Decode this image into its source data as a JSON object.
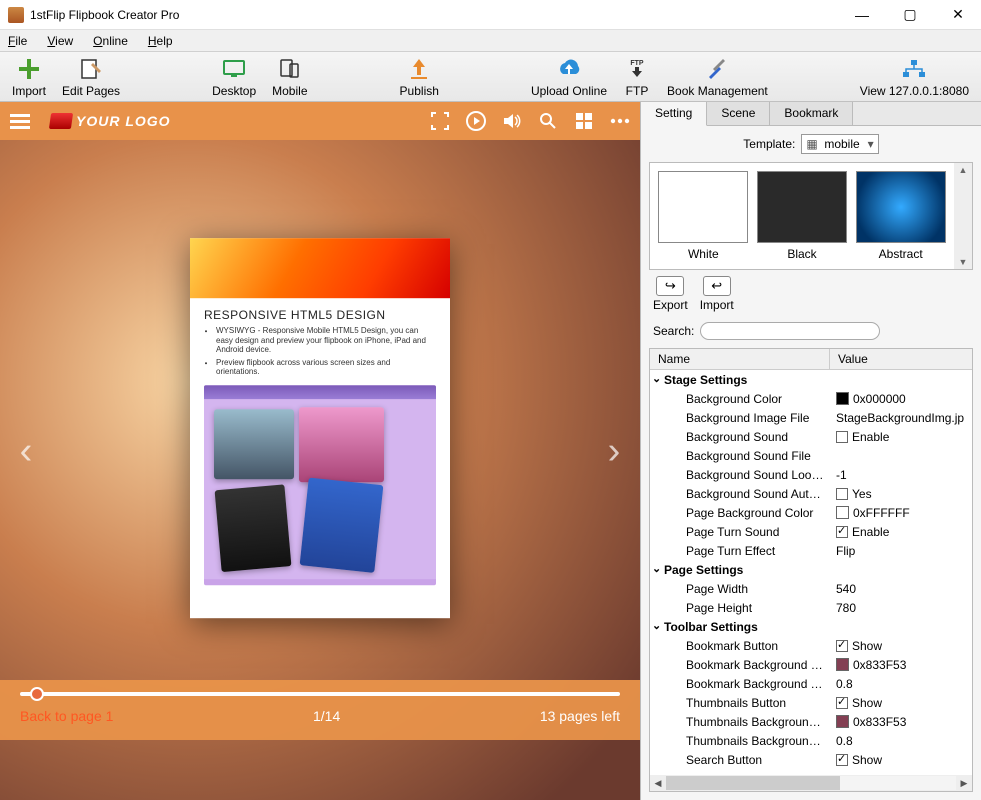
{
  "window": {
    "title": "1stFlip Flipbook Creator Pro"
  },
  "menu": {
    "file": "File",
    "view": "View",
    "online": "Online",
    "help": "Help"
  },
  "toolbar": {
    "import": "Import",
    "edit_pages": "Edit Pages",
    "desktop": "Desktop",
    "mobile": "Mobile",
    "publish": "Publish",
    "upload": "Upload Online",
    "ftp": "FTP",
    "book_mgmt": "Book Management",
    "view_addr": "View 127.0.0.1:8080"
  },
  "preview": {
    "logo": "YOUR LOGO",
    "book": {
      "heading": "RESPONSIVE HTML5 DESIGN",
      "b1": "WYSIWYG - Responsive Mobile HTML5 Design, you can easy design and preview your flipbook on iPhone, iPad and Android device.",
      "b2": "Preview flipbook across various screen sizes and orientations."
    },
    "back": "Back to page 1",
    "page": "1/14",
    "left": "13 pages left"
  },
  "panel": {
    "tabs": {
      "setting": "Setting",
      "scene": "Scene",
      "bookmark": "Bookmark"
    },
    "template_label": "Template:",
    "template_value": "mobile",
    "thumbs": {
      "white": "White",
      "black": "Black",
      "abstract": "Abstract"
    },
    "export": "Export",
    "import": "Import",
    "search_label": "Search:",
    "search_placeholder": "",
    "grid": {
      "name": "Name",
      "value": "Value"
    },
    "sections": {
      "stage": "Stage Settings",
      "page": "Page Settings",
      "toolbar": "Toolbar Settings"
    },
    "props": {
      "bg_color": {
        "n": "Background Color",
        "v": "0x000000",
        "c": "#000000"
      },
      "bg_img": {
        "n": "Background Image File",
        "v": "StageBackgroundImg.jp"
      },
      "bg_sound": {
        "n": "Background Sound",
        "v": "Enable",
        "chk": false
      },
      "bg_sound_file": {
        "n": "Background Sound File",
        "v": ""
      },
      "bg_sound_loops": {
        "n": "Background Sound Loops",
        "v": "-1"
      },
      "bg_sound_auto": {
        "n": "Background Sound Autoplay",
        "v": "Yes",
        "chk": false
      },
      "page_bg": {
        "n": "Page Background Color",
        "v": "0xFFFFFF",
        "c": "#FFFFFF"
      },
      "page_turn_sound": {
        "n": "Page Turn Sound",
        "v": "Enable",
        "chk": true
      },
      "page_turn_eff": {
        "n": "Page Turn Effect",
        "v": "Flip"
      },
      "page_w": {
        "n": "Page Width",
        "v": "540"
      },
      "page_h": {
        "n": "Page Height",
        "v": "780"
      },
      "bookmark_btn": {
        "n": "Bookmark Button",
        "v": "Show",
        "chk": true
      },
      "bookmark_bg": {
        "n": "Bookmark Background Color",
        "v": "0x833F53",
        "c": "#833F53"
      },
      "bookmark_bg_tr": {
        "n": "Bookmark Background Tra...",
        "v": "0.8"
      },
      "thumbs_btn": {
        "n": "Thumbnails Button",
        "v": "Show",
        "chk": true
      },
      "thumbs_bg": {
        "n": "Thumbnails Background C...",
        "v": "0x833F53",
        "c": "#833F53"
      },
      "thumbs_bg_tr": {
        "n": "Thumbnails Background Tr...",
        "v": "0.8"
      },
      "search_btn": {
        "n": "Search Button",
        "v": "Show",
        "chk": true
      }
    }
  }
}
